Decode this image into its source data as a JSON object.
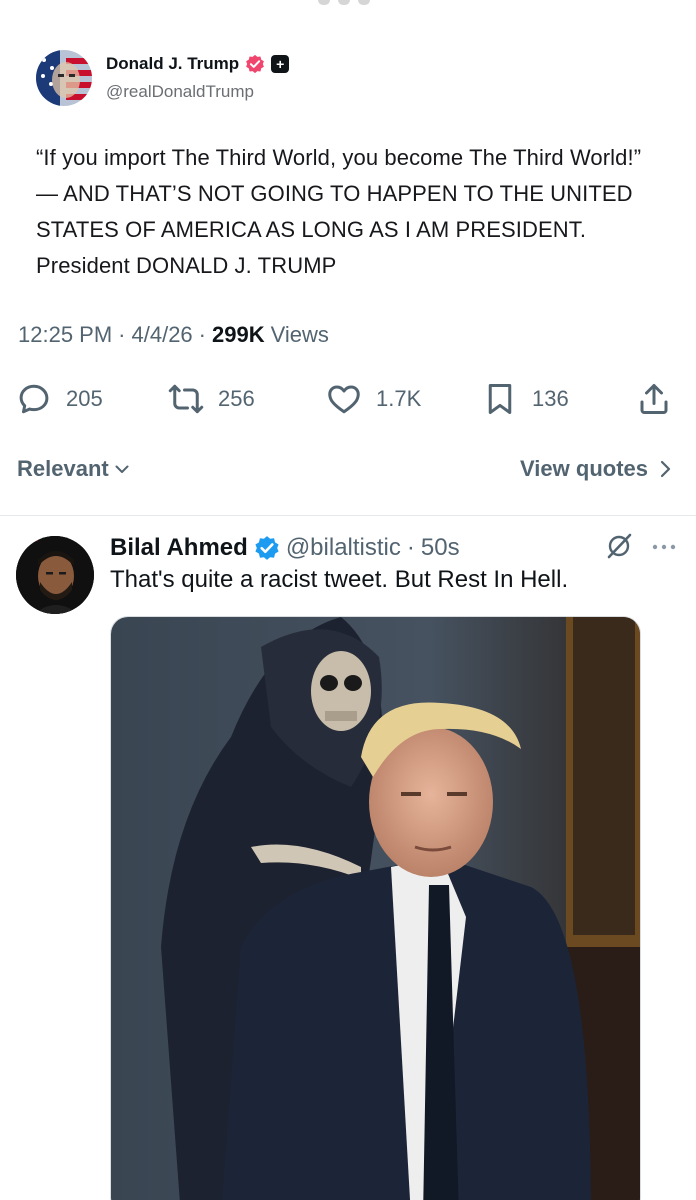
{
  "embedded_post": {
    "author_name": "Donald J. Trump",
    "author_handle": "@realDonaldTrump",
    "plus_badge": "+",
    "text": "“If you import The Third World, you become The Third World!” — AND THAT’S NOT GOING TO HAPPEN TO THE UNITED STATES OF AMERICA AS LONG AS I AM PRESIDENT. President DONALD J. TRUMP",
    "badge_color": "#f0466e"
  },
  "meta": {
    "time": "12:25 PM",
    "sep1": "·",
    "date": "4/4/26",
    "sep2": "·",
    "views_count": "299K",
    "views_label": "Views"
  },
  "actions": {
    "replies": "205",
    "reposts": "256",
    "likes": "1.7K",
    "bookmarks": "136",
    "icons": [
      "reply-icon",
      "repost-icon",
      "like-icon",
      "bookmark-icon",
      "share-icon"
    ]
  },
  "filters": {
    "relevant_label": "Relevant",
    "view_quotes_label": "View quotes"
  },
  "reply": {
    "name": "Bilal Ahmed",
    "handle": "@bilaltistic",
    "separator": "·",
    "time": "50s",
    "text": "That's quite a racist tweet. But Rest In Hell.",
    "verified_color": "#1d9bf0"
  }
}
